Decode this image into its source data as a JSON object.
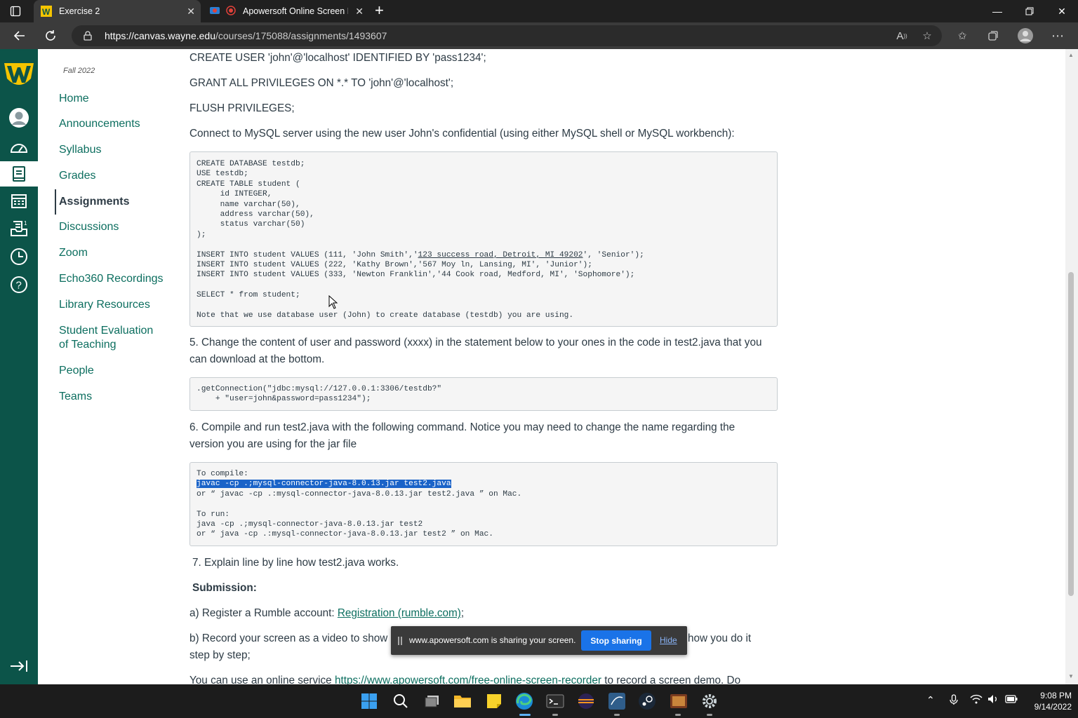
{
  "browser": {
    "tabs": [
      {
        "title": "Exercise 2",
        "active": true
      },
      {
        "title": "Apowersoft Online Screen R",
        "active": false
      }
    ],
    "url_host": "https://canvas.wayne.edu",
    "url_path": "/courses/175088/assignments/1493607"
  },
  "course_nav": {
    "term": "Fall 2022",
    "items": [
      {
        "label": "Home"
      },
      {
        "label": "Announcements"
      },
      {
        "label": "Syllabus"
      },
      {
        "label": "Grades"
      },
      {
        "label": "Assignments",
        "active": true
      },
      {
        "label": "Discussions"
      },
      {
        "label": "Zoom"
      },
      {
        "label": "Echo360 Recordings"
      },
      {
        "label": "Library Resources"
      },
      {
        "label": "Student Evaluation of Teaching"
      },
      {
        "label": "People"
      },
      {
        "label": "Teams"
      }
    ]
  },
  "content": {
    "line1": "CREATE USER 'john'@'localhost' IDENTIFIED BY 'pass1234';",
    "line2": "GRANT ALL PRIVILEGES ON *.* TO 'john'@'localhost';",
    "line3": "FLUSH PRIVILEGES;",
    "line4": "Connect to MySQL server using the new user John's confidential (using either MySQL shell or MySQL workbench):",
    "code1_a": "CREATE DATABASE testdb;\nUSE testdb;\nCREATE TABLE student (\n     id INTEGER,\n     name varchar(50),\n     address varchar(50),\n     status varchar(50)\n);\n\nINSERT INTO student VALUES (111, 'John Smith','",
    "code1_link": "123 success road, Detroit, MI 49202",
    "code1_b": "', 'Senior');\nINSERT INTO student VALUES (222, 'Kathy Brown','567 Moy ln, Lansing, MI', 'Junior');\nINSERT INTO student VALUES (333, 'Newton Franklin','44 Cook road, Medford, MI', 'Sophomore');\n\nSELECT * from student;\n\nNote that we use database user (John) to create database (testdb) you are using.",
    "step5": "5. Change the content of user and password (xxxx) in the statement below to your ones in the code in test2.java that you can download at the bottom.",
    "code2": ".getConnection(\"jdbc:mysql://127.0.0.1:3306/testdb?\"\n    + \"user=john&password=pass1234\");",
    "step6": "6. Compile and run test2.java with the following command. Notice you may need to change the name regarding the version you are using for the jar file",
    "code3_head": "To compile:",
    "code3_hl": "javac -cp .;mysql-connector-java-8.0.13.jar test2.java",
    "code3_rest": "or “ javac -cp .:mysql-connector-java-8.0.13.jar test2.java ” on Mac.\n\nTo run:\njava -cp .;mysql-connector-java-8.0.13.jar test2\nor “ java -cp .:mysql-connector-java-8.0.13.jar test2 ” on Mac.",
    "step7": "7.  Explain line by line how test2.java works.",
    "submission": "Submission:",
    "sub_a_prefix": "a) Register a Rumble account: ",
    "sub_a_link": "Registration (rumble.com)",
    "sub_a_suffix": ";",
    "sub_b_start": "b) Record your screen as a video to show",
    "sub_b_end": "how you do it",
    "sub_b_line2": "step by step;",
    "sub_c_prefix": "You can use an online service ",
    "sub_c_link": "https://www.apowersoft.com/free-online-screen-recorder",
    "sub_c_suffix": " to record a screen demo. Do"
  },
  "share_banner": {
    "text": "www.apowersoft.com is sharing your screen.",
    "stop_label": "Stop sharing",
    "hide_label": "Hide"
  },
  "taskbar": {
    "time": "9:08 PM",
    "date": "9/14/2022"
  },
  "colors": {
    "canvas_nav": "#0c5449",
    "link": "#0c6e5f",
    "share_button": "#1a73e8"
  }
}
